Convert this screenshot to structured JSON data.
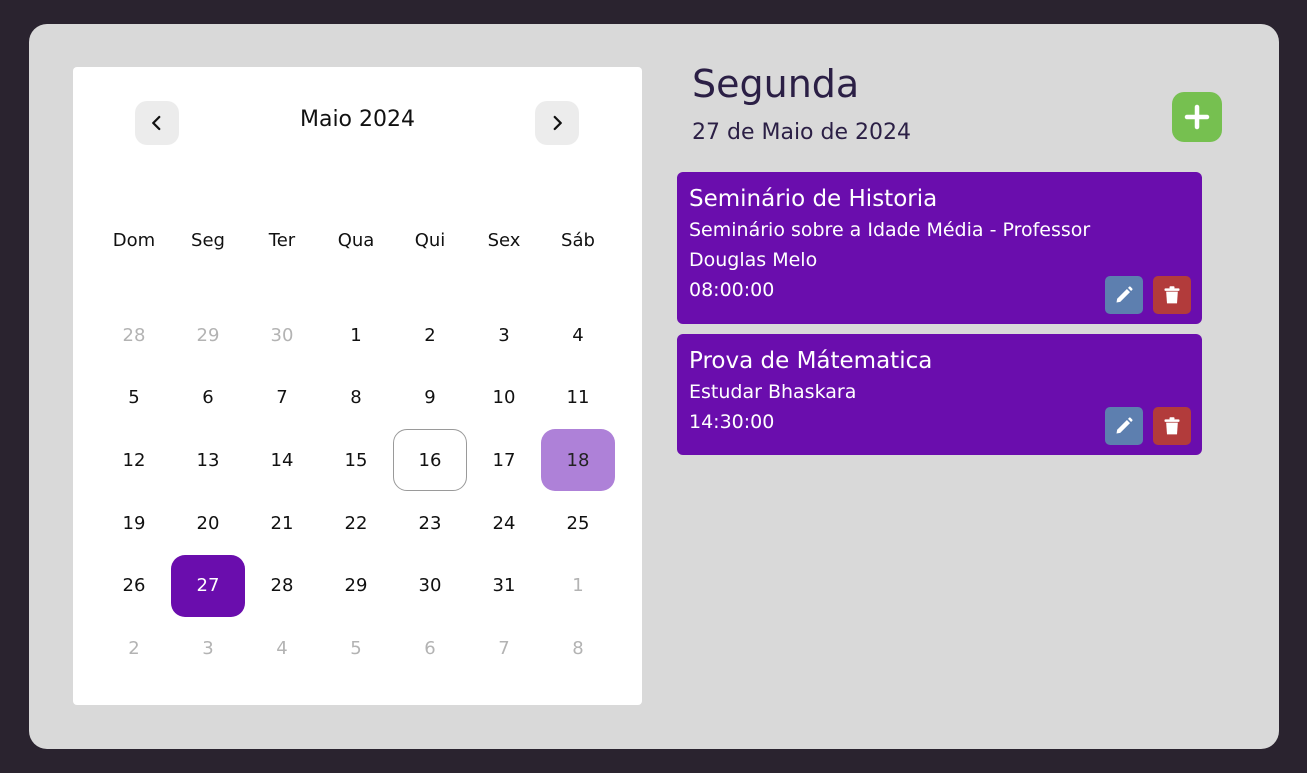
{
  "calendar": {
    "month_label": "Maio 2024",
    "weekdays": [
      "Dom",
      "Seg",
      "Ter",
      "Qua",
      "Qui",
      "Sex",
      "Sáb"
    ],
    "days": [
      {
        "label": "28",
        "state": "other"
      },
      {
        "label": "29",
        "state": "other"
      },
      {
        "label": "30",
        "state": "other"
      },
      {
        "label": "1",
        "state": "current"
      },
      {
        "label": "2",
        "state": "current"
      },
      {
        "label": "3",
        "state": "current"
      },
      {
        "label": "4",
        "state": "current"
      },
      {
        "label": "5",
        "state": "current"
      },
      {
        "label": "6",
        "state": "current"
      },
      {
        "label": "7",
        "state": "current"
      },
      {
        "label": "8",
        "state": "current"
      },
      {
        "label": "9",
        "state": "current"
      },
      {
        "label": "10",
        "state": "current"
      },
      {
        "label": "11",
        "state": "current"
      },
      {
        "label": "12",
        "state": "current"
      },
      {
        "label": "13",
        "state": "current"
      },
      {
        "label": "14",
        "state": "current"
      },
      {
        "label": "15",
        "state": "current"
      },
      {
        "label": "16",
        "state": "today"
      },
      {
        "label": "17",
        "state": "current"
      },
      {
        "label": "18",
        "state": "marked"
      },
      {
        "label": "19",
        "state": "current"
      },
      {
        "label": "20",
        "state": "current"
      },
      {
        "label": "21",
        "state": "current"
      },
      {
        "label": "22",
        "state": "current"
      },
      {
        "label": "23",
        "state": "current"
      },
      {
        "label": "24",
        "state": "current"
      },
      {
        "label": "25",
        "state": "current"
      },
      {
        "label": "26",
        "state": "current"
      },
      {
        "label": "27",
        "state": "selected"
      },
      {
        "label": "28",
        "state": "current"
      },
      {
        "label": "29",
        "state": "current"
      },
      {
        "label": "30",
        "state": "current"
      },
      {
        "label": "31",
        "state": "current"
      },
      {
        "label": "1",
        "state": "other"
      },
      {
        "label": "2",
        "state": "other"
      },
      {
        "label": "3",
        "state": "other"
      },
      {
        "label": "4",
        "state": "other"
      },
      {
        "label": "5",
        "state": "other"
      },
      {
        "label": "6",
        "state": "other"
      },
      {
        "label": "7",
        "state": "other"
      },
      {
        "label": "8",
        "state": "other"
      }
    ],
    "prev_icon": "chevron-left-icon",
    "next_icon": "chevron-right-icon"
  },
  "detail": {
    "day_name": "Segunda",
    "full_date": "27 de Maio de 2024",
    "add_icon": "plus-icon"
  },
  "events": [
    {
      "title": "Seminário de Historia",
      "description": "Seminário sobre a Idade Média - Professor Douglas Melo",
      "time": "08:00:00"
    },
    {
      "title": "Prova de Mátematica",
      "description": "Estudar Bhaskara",
      "time": "14:30:00"
    }
  ],
  "colors": {
    "background": "#2a232f",
    "panel": "#d9d9d9",
    "selected_day": "#6a0dad",
    "marked_day": "#ae81d8",
    "event_card": "#6a0dad",
    "add_button": "#76c050",
    "edit_button": "#5d7faf",
    "delete_button": "#b23b3b"
  }
}
